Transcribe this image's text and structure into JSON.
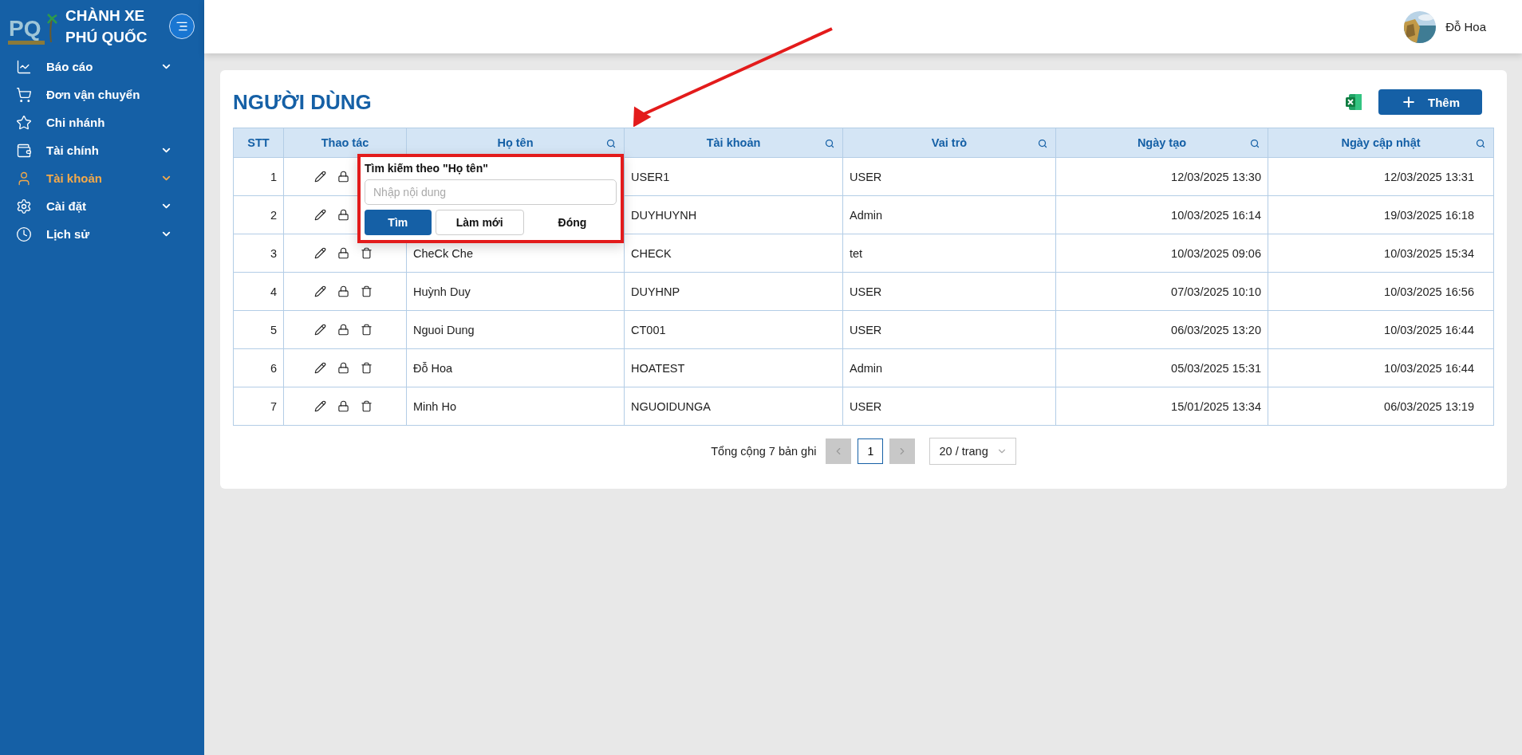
{
  "brand": {
    "logo_text": "PQ",
    "title_lines": [
      "CHÀNH XE",
      "PHÚ QUỐC"
    ]
  },
  "sidebar": {
    "items": [
      {
        "label": "Báo cáo",
        "expandable": true,
        "selected": false
      },
      {
        "label": "Đơn vận chuyển",
        "expandable": false,
        "selected": false
      },
      {
        "label": "Chi nhánh",
        "expandable": false,
        "selected": false
      },
      {
        "label": "Tài chính",
        "expandable": true,
        "selected": false
      },
      {
        "label": "Tài khoản",
        "expandable": true,
        "selected": true
      },
      {
        "label": "Cài đặt",
        "expandable": true,
        "selected": false
      },
      {
        "label": "Lịch sử",
        "expandable": true,
        "selected": false
      }
    ]
  },
  "header": {
    "user_name": "Đỗ Hoa"
  },
  "page": {
    "title": "NGƯỜI DÙNG",
    "add_button": "Thêm"
  },
  "table": {
    "columns": [
      {
        "label": "STT",
        "kind": "index",
        "searchable": false
      },
      {
        "label": "Thao tác",
        "kind": "actions",
        "searchable": false
      },
      {
        "label": "Họ tên",
        "kind": "text",
        "searchable": true
      },
      {
        "label": "Tài khoản",
        "kind": "text",
        "searchable": true
      },
      {
        "label": "Vai trò",
        "kind": "text",
        "searchable": true
      },
      {
        "label": "Ngày tạo",
        "kind": "date",
        "searchable": true
      },
      {
        "label": "Ngày cập nhật",
        "kind": "date",
        "searchable": true
      }
    ],
    "rows": [
      {
        "cells": [
          "1",
          null,
          null,
          "USER1",
          "USER",
          "12/03/2025 13:30",
          "12/03/2025 13:31"
        ]
      },
      {
        "cells": [
          "2",
          null,
          null,
          "DUYHUYNH",
          "Admin",
          "10/03/2025 16:14",
          "19/03/2025 16:18"
        ]
      },
      {
        "cells": [
          "3",
          null,
          "CheCk Che",
          "CHECK",
          "tet",
          "10/03/2025 09:06",
          "10/03/2025 15:34"
        ]
      },
      {
        "cells": [
          "4",
          null,
          "Huỳnh Duy",
          "DUYHNP",
          "USER",
          "07/03/2025 10:10",
          "10/03/2025 16:56"
        ]
      },
      {
        "cells": [
          "5",
          null,
          "Nguoi Dung",
          "CT001",
          "USER",
          "06/03/2025 13:20",
          "10/03/2025 16:44"
        ]
      },
      {
        "cells": [
          "6",
          null,
          "Đỗ Hoa",
          "HOATEST",
          "Admin",
          "05/03/2025 15:31",
          "10/03/2025 16:44"
        ]
      },
      {
        "cells": [
          "7",
          null,
          "Minh Ho",
          "NGUOIDUNGA",
          "USER",
          "15/01/2025 13:34",
          "06/03/2025 13:19"
        ]
      }
    ]
  },
  "search_popup": {
    "title": "Tìm kiếm theo \"Họ tên\"",
    "placeholder": "Nhập nội dung",
    "buttons": [
      {
        "label": "Tìm",
        "kind": "primary"
      },
      {
        "label": "Làm mới",
        "kind": "outline"
      },
      {
        "label": "Đóng",
        "kind": "text"
      }
    ]
  },
  "pagination": {
    "total": "Tổng cộng 7 bản ghi",
    "prev_disabled": true,
    "next_disabled": true,
    "pages": [
      {
        "label": "1",
        "selected": true
      }
    ],
    "page_size": "20 / trang"
  }
}
